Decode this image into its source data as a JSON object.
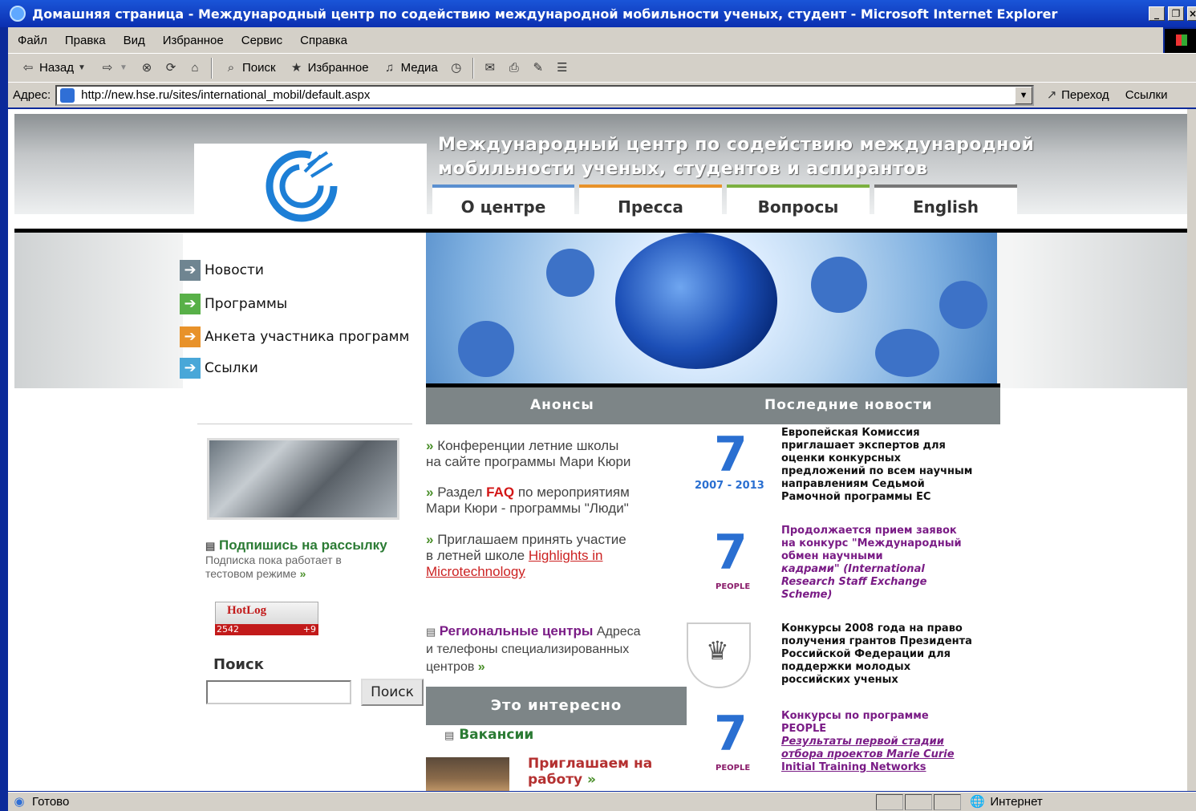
{
  "window": {
    "title": "Домашняя страница - Международный центр по содействию международной мобильности ученых, студент - Microsoft Internet Explorer"
  },
  "menu": [
    "Файл",
    "Правка",
    "Вид",
    "Избранное",
    "Сервис",
    "Справка"
  ],
  "toolbar": {
    "back": "Назад",
    "search": "Поиск",
    "favorites": "Избранное",
    "media": "Медиа"
  },
  "address": {
    "label": "Адрес:",
    "url": "http://new.hse.ru/sites/international_mobil/default.aspx",
    "go": "Переход",
    "links": "Ссылки"
  },
  "status": {
    "text": "Готово",
    "zone": "Интернет"
  },
  "page": {
    "site_title_line1": "Международный центр по содействию международной",
    "site_title_line2": "мобильности ученых, студентов и аспирантов",
    "nav": [
      {
        "label": "О центре",
        "color": "#5a8fd0"
      },
      {
        "label": "Пресса",
        "color": "#e8922a"
      },
      {
        "label": "Вопросы",
        "color": "#7cb040"
      },
      {
        "label": "English",
        "color": "#777777"
      }
    ],
    "side_menu": [
      {
        "label": "Новости",
        "color": "#6f8591"
      },
      {
        "label": "Программы",
        "color": "#58b048"
      },
      {
        "label": "Анкета участника программ",
        "color": "#e8922a"
      },
      {
        "label": "Ссылки",
        "color": "#49a7d8"
      }
    ],
    "subscribe": {
      "title": "Подпишись на рассылку",
      "line1": "Подписка пока работает в",
      "line2": "тестовом режиме"
    },
    "hotlog": {
      "brand": "HotLog",
      "count": "2542",
      "delta": "+9"
    },
    "search": {
      "label": "Поиск",
      "button": "Поиск"
    },
    "sections": {
      "announcements": "Анонсы",
      "latest_news": "Последние новости",
      "interesting": "Это интересно"
    },
    "announcements": {
      "a1_line1": "Конференции летние школы",
      "a1_line2": "на сайте программы Мари Кюри",
      "a2_pre": "Раздел",
      "a2_faq": "FAQ",
      "a2_post": "по мероприятиям",
      "a2_line2": "Мари Кюри - программы \"Люди\"",
      "a3_line1": "Приглашаем принять участие",
      "a3_line2_pre": "в летней школе",
      "a3_link1": "Highlights in",
      "a3_link2": "Microtechnology"
    },
    "regional": {
      "title": "Региональные центры",
      "text1": "Адреса",
      "text2": "и телефоны специализированных",
      "text3": "центров"
    },
    "vacancies": "Вакансии",
    "work": {
      "line1": "Приглашаем на",
      "line2": "работу"
    },
    "news": [
      {
        "lines": [
          "Европейская Комиссия",
          "приглашает экспертов для",
          "оценки конкурсных",
          "предложений по всем научным",
          "направлениям Седьмой",
          "Рамочной программы ЕС"
        ],
        "image_caption": "2007 - 2013"
      },
      {
        "lines": [
          "Продолжается прием заявок",
          "на конкурс \"Международный",
          "обмен научными",
          "кадрами\" (International",
          "Research Staff Exchange",
          "Scheme)"
        ],
        "image_caption": "PEOPLE"
      },
      {
        "lines": [
          "Конкурсы 2008 года на право",
          "получения грантов Президента",
          "Российской Федерации для",
          "поддержки молодых",
          "российских ученых"
        ],
        "image_caption": ""
      },
      {
        "lines": [
          "Конкурсы по программе",
          "PEOPLE"
        ],
        "links": [
          "Результаты первой стадии",
          "отбора проектов Marie Curie",
          "Initial Training Networks"
        ],
        "image_caption": "PEOPLE"
      }
    ]
  }
}
